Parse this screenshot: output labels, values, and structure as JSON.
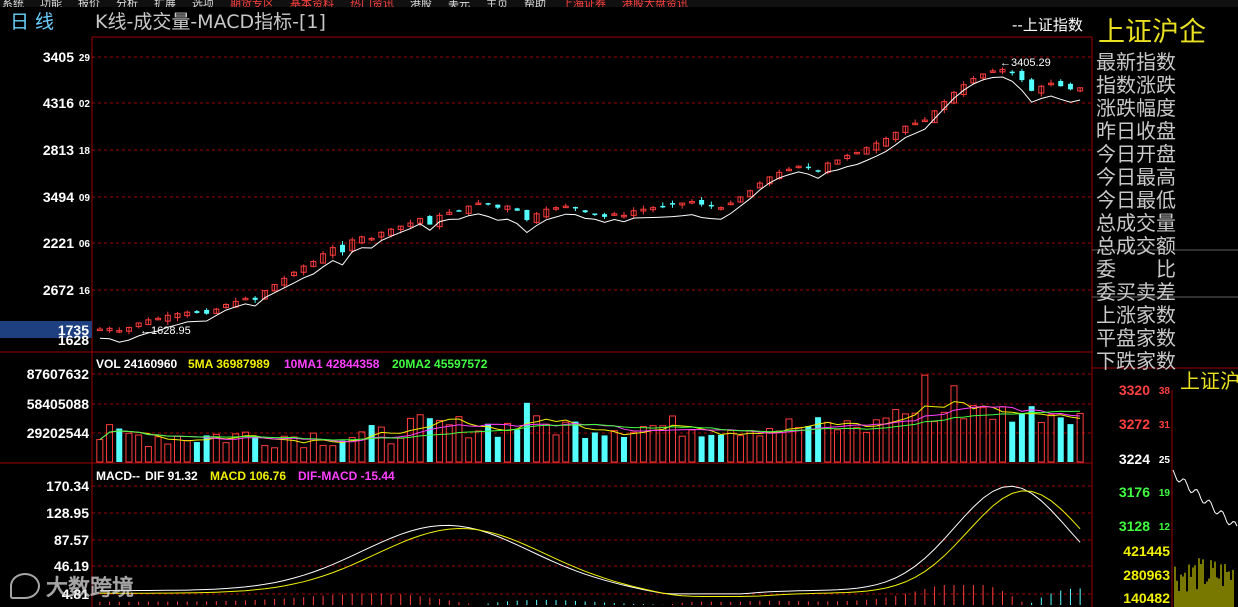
{
  "top_menu": [
    "系统",
    "功能",
    "报价",
    "分析",
    "扩展",
    "选项",
    "期货专区",
    "基本资料",
    "热门资讯",
    "港股",
    "美元",
    "主页",
    "帮助",
    "上海证券",
    "港股大盘资讯"
  ],
  "header": {
    "period": "日  线",
    "title": "K线-成交量-MACD指标-[1]",
    "legend_item": "--上证指数",
    "index_name": "上证沪企"
  },
  "info_labels": [
    "最新指数",
    "指数涨跌",
    "涨跌幅度",
    "昨日收盘",
    "今日开盘",
    "今日最高",
    "今日最低",
    "总成交量",
    "总成交额",
    "委　　比",
    "委买卖差",
    "上涨家数",
    "平盘家数",
    "下跌家数"
  ],
  "mini_chart": {
    "title": "上证沪",
    "price_ticks": [
      "332038",
      "327231",
      "322425",
      "317619",
      "312812"
    ],
    "volume_ticks": [
      "421445",
      "280963",
      "140482"
    ]
  },
  "price_axis": {
    "tick_labels": [
      "340529",
      "431602",
      "281318",
      "349409",
      "222106",
      "267216",
      "173566",
      "162825"
    ],
    "highlight_label": "173566",
    "max_label": "3405.29",
    "min_label": "1628.95"
  },
  "volume_panel": {
    "header": {
      "vol": "VOL 24160960",
      "ma5": "5MA 36987989",
      "ma10": "10MA1 42844358",
      "ma20": "20MA2 45597572"
    },
    "tick_labels": [
      "87607632",
      "58405088",
      "29202544"
    ]
  },
  "macd_panel": {
    "header": {
      "name": "MACD--",
      "dif": "DIF 91.32",
      "macd": "MACD 106.76",
      "difmacd": "DIF-MACD -15.44"
    },
    "tick_labels": [
      "170.34",
      "128.95",
      "87.57",
      "46.19",
      "4.81"
    ]
  },
  "watermark": "大数跨境",
  "colors": {
    "up": "#ff3c3c",
    "down": "#54ffff",
    "ma5": "#f0f000",
    "ma10": "#ff40ff",
    "ma20": "#40ff40",
    "grid": "#a00000",
    "dif": "#ffffff",
    "dea": "#f0f000"
  },
  "chart_data": {
    "type": "candlestick",
    "title": "K线-成交量-MACD指标-[1]",
    "series_name": "上证指数",
    "price_range": [
      1628.95,
      3405.29
    ],
    "price_close_trend": [
      1700,
      1705,
      1690,
      1710,
      1740,
      1760,
      1770,
      1790,
      1800,
      1810,
      1805,
      1800,
      1830,
      1860,
      1880,
      1900,
      1890,
      1950,
      1990,
      2030,
      2070,
      2110,
      2140,
      2190,
      2230,
      2200,
      2280,
      2300,
      2290,
      2330,
      2350,
      2370,
      2390,
      2420,
      2380,
      2440,
      2460,
      2470,
      2500,
      2520,
      2510,
      2490,
      2500,
      2470,
      2410,
      2450,
      2480,
      2490,
      2500,
      2490,
      2460,
      2450,
      2430,
      2450,
      2440,
      2470,
      2480,
      2490,
      2500,
      2510,
      2520,
      2530,
      2510,
      2500,
      2490,
      2520,
      2560,
      2600,
      2650,
      2690,
      2720,
      2740,
      2760,
      2750,
      2730,
      2780,
      2800,
      2830,
      2850,
      2880,
      2910,
      2940,
      2980,
      3020,
      3040,
      3060,
      3120,
      3180,
      3240,
      3290,
      3330,
      3360,
      3380,
      3390,
      3370,
      3320,
      3250,
      3280,
      3300,
      3280,
      3260,
      3270
    ],
    "volume_scale": {
      "ticks": [
        29202544,
        58405088,
        87607632
      ]
    },
    "volume_last": 24160960,
    "ma5": 36987989,
    "ma10": 42844358,
    "ma20": 45597572,
    "macd_range": [
      4.81,
      170.34
    ],
    "dif_last": 91.32,
    "macd_last": 106.76,
    "difmacd_last": -15.44
  }
}
